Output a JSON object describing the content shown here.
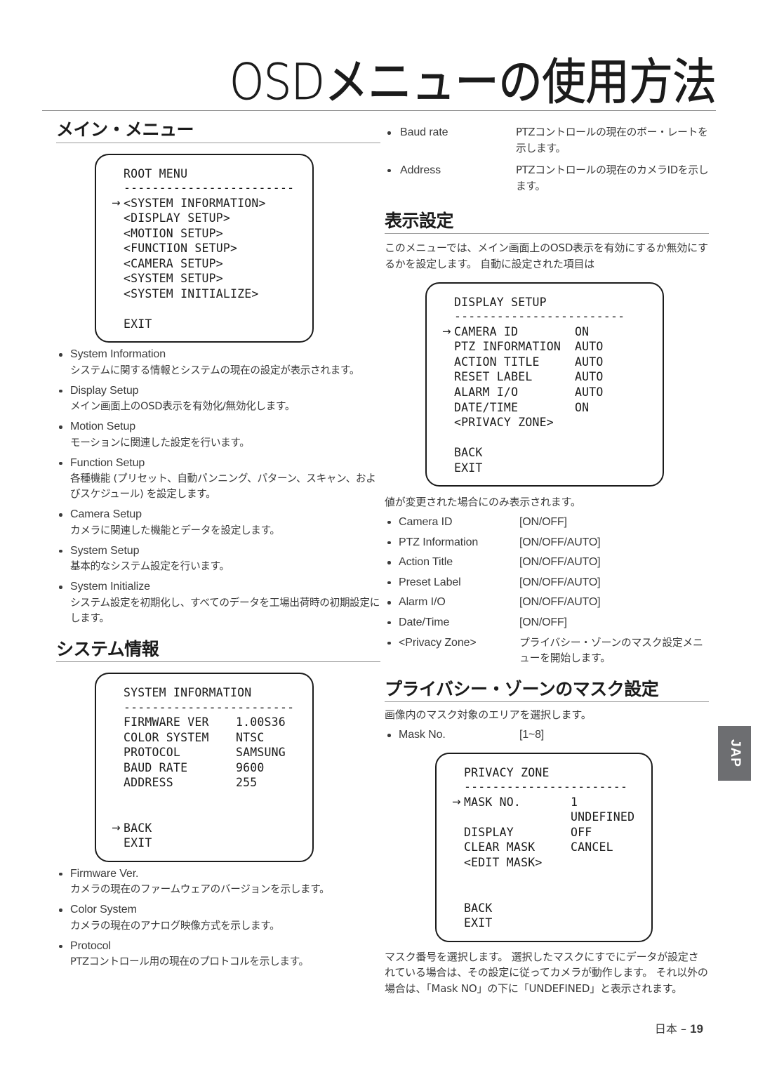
{
  "header": {
    "title": "OSDメニューの使用方法"
  },
  "side_tab": {
    "label": "JAP"
  },
  "footer": {
    "lang": "日本 – ",
    "page": "19"
  },
  "left": {
    "section_main_menu": {
      "heading": "メイン・メニュー"
    },
    "root_menu_box": {
      "title": "ROOT MENU",
      "dash": "------------------------",
      "rows": [
        {
          "arrow": "→",
          "label": "<SYSTEM INFORMATION>"
        },
        {
          "arrow": "",
          "label": "<DISPLAY SETUP>"
        },
        {
          "arrow": "",
          "label": "<MOTION SETUP>"
        },
        {
          "arrow": "",
          "label": "<FUNCTION SETUP>"
        },
        {
          "arrow": "",
          "label": "<CAMERA SETUP>"
        },
        {
          "arrow": "",
          "label": "<SYSTEM SETUP>"
        },
        {
          "arrow": "",
          "label": "<SYSTEM INITIALIZE>"
        },
        {
          "arrow": "",
          "label": " "
        },
        {
          "arrow": "",
          "label": "EXIT"
        }
      ]
    },
    "menu_items": [
      {
        "term": "System Information",
        "desc": "システムに関する情報とシステムの現在の設定が表示されます。"
      },
      {
        "term": "Display Setup",
        "desc": "メイン画面上のOSD表示を有効化/無効化します。"
      },
      {
        "term": "Motion Setup",
        "desc": "モーションに関連した設定を行います。"
      },
      {
        "term": "Function Setup",
        "desc": "各種機能 (プリセット、自動パンニング、パターン、スキャン、およびスケジュール) を設定します。"
      },
      {
        "term": "Camera Setup",
        "desc": "カメラに関連した機能とデータを設定します。"
      },
      {
        "term": "System Setup",
        "desc": "基本的なシステム設定を行います。"
      },
      {
        "term": "System Initialize",
        "desc": "システム設定を初期化し、すべてのデータを工場出荷時の初期設定にします。"
      }
    ],
    "section_system_info": {
      "heading": "システム情報"
    },
    "system_info_box": {
      "title": "SYSTEM INFORMATION",
      "dash": "------------------------",
      "rows": [
        {
          "arrow": "",
          "label": "FIRMWARE VER",
          "value": "1.00S36"
        },
        {
          "arrow": "",
          "label": "COLOR SYSTEM",
          "value": "NTSC"
        },
        {
          "arrow": "",
          "label": "PROTOCOL",
          "value": "SAMSUNG"
        },
        {
          "arrow": "",
          "label": "BAUD RATE",
          "value": "9600"
        },
        {
          "arrow": "",
          "label": "ADDRESS",
          "value": "255"
        },
        {
          "arrow": "",
          "label": " ",
          "value": ""
        },
        {
          "arrow": "",
          "label": " ",
          "value": ""
        },
        {
          "arrow": "→",
          "label": "BACK",
          "value": ""
        },
        {
          "arrow": "",
          "label": "EXIT",
          "value": ""
        }
      ]
    },
    "system_info_items": [
      {
        "term": "Firmware Ver.",
        "desc": "カメラの現在のファームウェアのバージョンを示します。"
      },
      {
        "term": "Color System",
        "desc": "カメラの現在のアナログ映像方式を示します。"
      },
      {
        "term": "Protocol",
        "desc": "PTZコントロール用の現在のプロトコルを示します。"
      }
    ]
  },
  "right": {
    "top_items": [
      {
        "term": "Baud rate",
        "desc": "PTZコントロールの現在のボー・レートを示します。"
      },
      {
        "term": "Address",
        "desc": "PTZコントロールの現在のカメラIDを示します。"
      }
    ],
    "section_display": {
      "heading": "表示設定"
    },
    "display_intro": "このメニューでは、メイン画面上のOSD表示を有効にするか無効にするかを設定します。 自動に設定された項目は",
    "display_box": {
      "title": "DISPLAY SETUP",
      "dash": "------------------------",
      "rows": [
        {
          "arrow": "→",
          "label": "CAMERA ID",
          "value": "ON"
        },
        {
          "arrow": "",
          "label": "PTZ INFORMATION",
          "value": "AUTO"
        },
        {
          "arrow": "",
          "label": "ACTION TITLE",
          "value": "AUTO"
        },
        {
          "arrow": "",
          "label": "RESET LABEL",
          "value": "AUTO"
        },
        {
          "arrow": "",
          "label": "ALARM I/O",
          "value": "AUTO"
        },
        {
          "arrow": "",
          "label": "DATE/TIME",
          "value": "ON"
        },
        {
          "arrow": "",
          "label": "<PRIVACY ZONE>",
          "value": ""
        },
        {
          "arrow": "",
          "label": " ",
          "value": ""
        },
        {
          "arrow": "",
          "label": "BACK",
          "value": ""
        },
        {
          "arrow": "",
          "label": "EXIT",
          "value": ""
        }
      ]
    },
    "display_note": "値が変更された場合にのみ表示されます。",
    "display_items": [
      {
        "term": "Camera ID",
        "value": "[ON/OFF]",
        "jp": false
      },
      {
        "term": "PTZ Information",
        "value": "[ON/OFF/AUTO]",
        "jp": false
      },
      {
        "term": "Action Title",
        "value": "[ON/OFF/AUTO]",
        "jp": false
      },
      {
        "term": "Preset Label",
        "value": "[ON/OFF/AUTO]",
        "jp": false
      },
      {
        "term": "Alarm I/O",
        "value": "[ON/OFF/AUTO]",
        "jp": false
      },
      {
        "term": "Date/Time",
        "value": "[ON/OFF]",
        "jp": false
      },
      {
        "term": "<Privacy Zone>",
        "value": "プライバシー・ゾーンのマスク設定メニューを開始します。",
        "jp": true
      }
    ],
    "section_privacy": {
      "heading": "プライバシー・ゾーンのマスク設定"
    },
    "privacy_intro": "画像内のマスク対象のエリアを選択します。",
    "privacy_items": [
      {
        "term": "Mask No.",
        "value": "[1~8]"
      }
    ],
    "privacy_box": {
      "title": "PRIVACY ZONE",
      "dash": "-----------------------",
      "rows": [
        {
          "arrow": "→",
          "label": "MASK NO.",
          "value": "1"
        },
        {
          "arrow": "",
          "label": " ",
          "value": "UNDEFINED"
        },
        {
          "arrow": "",
          "label": "DISPLAY",
          "value": "OFF"
        },
        {
          "arrow": "",
          "label": "CLEAR MASK",
          "value": "CANCEL"
        },
        {
          "arrow": "",
          "label": "<EDIT MASK>",
          "value": ""
        },
        {
          "arrow": "",
          "label": " ",
          "value": ""
        },
        {
          "arrow": "",
          "label": " ",
          "value": ""
        },
        {
          "arrow": "",
          "label": "BACK",
          "value": ""
        },
        {
          "arrow": "",
          "label": "EXIT",
          "value": ""
        }
      ]
    },
    "privacy_note": "マスク番号を選択します。 選択したマスクにすでにデータが設定されている場合は、その設定に従ってカメラが動作します。 それ以外の場合は、「Mask NO」の下に「UNDEFINED」と表示されます。"
  }
}
